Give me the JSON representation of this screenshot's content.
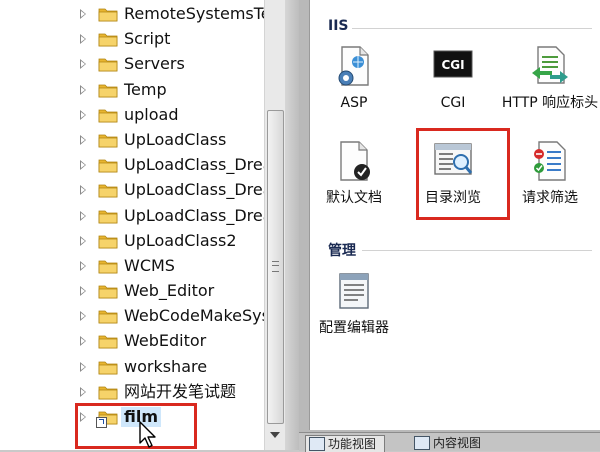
{
  "tree": {
    "items": [
      {
        "label": "RemoteSystemsTer"
      },
      {
        "label": "Script"
      },
      {
        "label": "Servers"
      },
      {
        "label": "Temp"
      },
      {
        "label": "upload"
      },
      {
        "label": "UpLoadClass"
      },
      {
        "label": "UpLoadClass_Dreac"
      },
      {
        "label": "UpLoadClass_Dreac"
      },
      {
        "label": "UpLoadClass_Dreac"
      },
      {
        "label": "UpLoadClass2"
      },
      {
        "label": "WCMS"
      },
      {
        "label": "Web_Editor"
      },
      {
        "label": "WebCodeMakeSyst"
      },
      {
        "label": "WebEditor"
      },
      {
        "label": "workshare"
      },
      {
        "label": "网站开发笔试题"
      },
      {
        "label": "film"
      }
    ]
  },
  "features": {
    "iis_group_title": "IIS",
    "manage_group_title": "管理",
    "iis_items": [
      {
        "label": "ASP",
        "icon": "asp-icon"
      },
      {
        "label": "CGI",
        "icon": "cgi-icon",
        "icon_text": "CGI"
      },
      {
        "label": "HTTP 响应标头",
        "icon": "http-headers-icon"
      },
      {
        "label": "默认文档",
        "icon": "default-document-icon"
      },
      {
        "label": "目录浏览",
        "icon": "directory-browsing-icon"
      },
      {
        "label": "请求筛选",
        "icon": "request-filtering-icon"
      }
    ],
    "manage_items": [
      {
        "label": "配置编辑器",
        "icon": "configuration-editor-icon"
      }
    ]
  },
  "bottom_tabs": {
    "features_view": "功能视图",
    "content_view": "内容视图"
  },
  "colors": {
    "highlight_red": "#d9291f",
    "selection_blue": "#cfe7fb",
    "folder_yellow": "#f2c94c"
  }
}
